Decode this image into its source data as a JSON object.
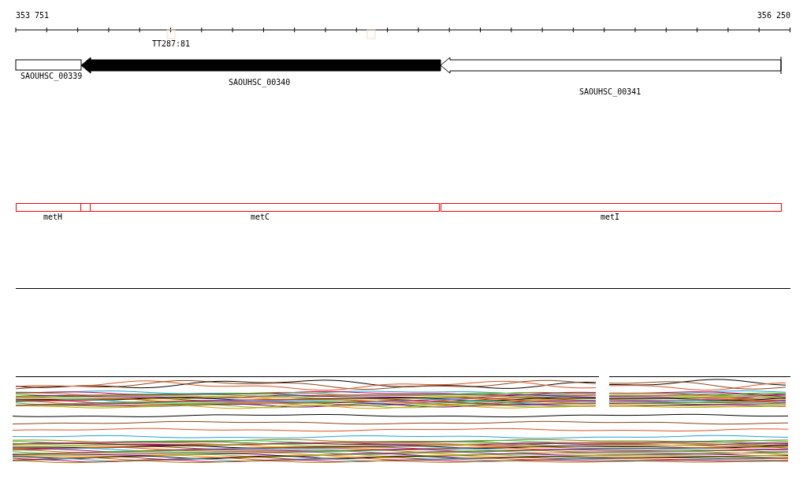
{
  "ruler": {
    "start_label": "353 751",
    "end_label": "356 250"
  },
  "ruler_markers": [
    {
      "label": "TT287:81"
    }
  ],
  "genes": [
    {
      "name": "SAOUHSC_00339",
      "selected": false
    },
    {
      "name": "SAOUHSC_00340",
      "selected": true
    },
    {
      "name": "SAOUHSC_00341",
      "selected": false
    }
  ],
  "operon_segments": [
    {
      "label": "metH"
    },
    {
      "label": "metC"
    },
    {
      "label": "metI"
    }
  ]
}
